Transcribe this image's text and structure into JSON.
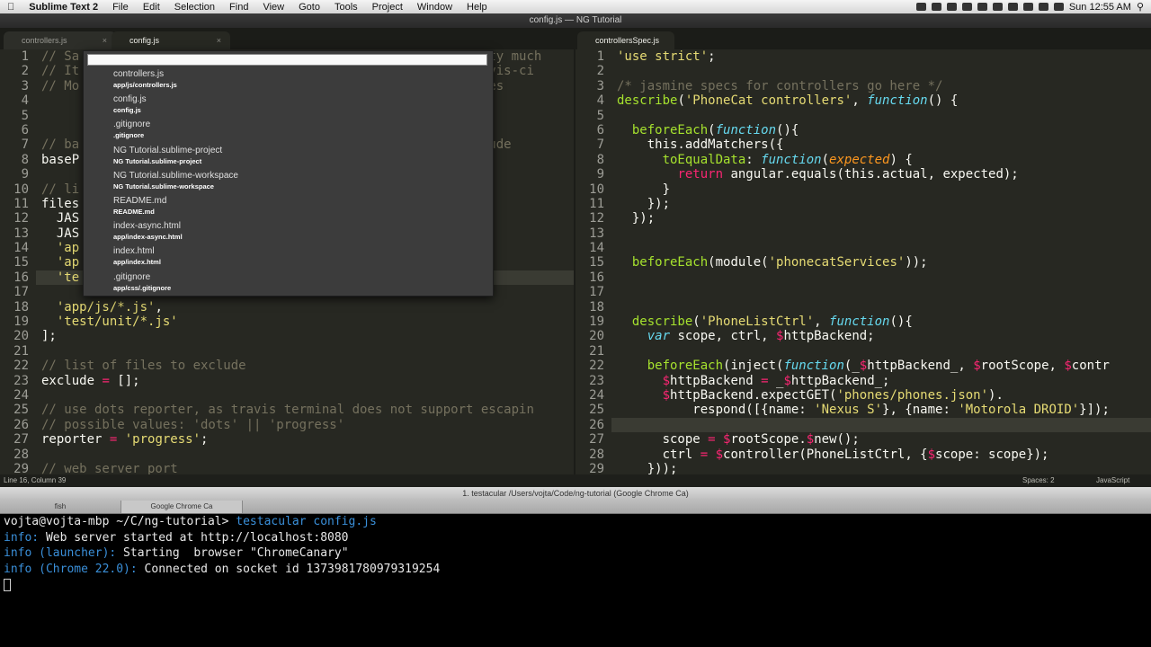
{
  "menubar": {
    "app": "Sublime Text 2",
    "items": [
      "File",
      "Edit",
      "Selection",
      "Find",
      "View",
      "Goto",
      "Tools",
      "Project",
      "Window",
      "Help"
    ],
    "clock": "Sun 12:55 AM"
  },
  "window_title": "config.js — NG Tutorial",
  "left_tabs": [
    {
      "label": "controllers.js",
      "close": "×"
    },
    {
      "label": "config.js",
      "close": "×"
    }
  ],
  "right_tabs": [
    {
      "label": "controllersSpec.js"
    }
  ],
  "goto_anything": {
    "input_value": "",
    "items": [
      {
        "name": "controllers.js",
        "path": "app/js/controllers.js"
      },
      {
        "name": "config.js",
        "path": "config.js"
      },
      {
        "name": ".gitignore",
        "path": ".gitignore"
      },
      {
        "name": "NG Tutorial.sublime-project",
        "path": "NG Tutorial.sublime-project"
      },
      {
        "name": "NG Tutorial.sublime-workspace",
        "path": "NG Tutorial.sublime-workspace"
      },
      {
        "name": "README.md",
        "path": "README.md"
      },
      {
        "name": "index-async.html",
        "path": "app/index-async.html"
      },
      {
        "name": "index.html",
        "path": "app/index.html"
      },
      {
        "name": ".gitignore",
        "path": "app/css/.gitignore"
      }
    ]
  },
  "left_code": {
    "current_line": 16,
    "lines": [
      {
        "n": "1",
        "t": [
          [
            "c",
            "// Sa"
          ],
          [
            "c",
            "                                                  pretty much"
          ]
        ]
      },
      {
        "n": "2",
        "t": [
          [
            "c",
            "// It"
          ],
          [
            "c",
            "                                                  /travis-ci"
          ]
        ]
      },
      {
        "n": "3",
        "t": [
          [
            "c",
            "// Mo"
          ],
          [
            "c",
            "                                              s (see tes"
          ]
        ]
      },
      {
        "n": "4",
        "t": []
      },
      {
        "n": "5",
        "t": []
      },
      {
        "n": "6",
        "t": []
      },
      {
        "n": "7",
        "t": [
          [
            "c",
            "// ba"
          ],
          [
            "c",
            "                                                   xclude"
          ]
        ]
      },
      {
        "n": "8",
        "t": [
          [
            "",
            "baseP"
          ]
        ]
      },
      {
        "n": "9",
        "t": []
      },
      {
        "n": "10",
        "t": [
          [
            "c",
            "// li"
          ]
        ]
      },
      {
        "n": "11",
        "t": [
          [
            "",
            "files"
          ]
        ]
      },
      {
        "n": "12",
        "t": [
          [
            "",
            "  JAS"
          ]
        ]
      },
      {
        "n": "13",
        "t": [
          [
            "",
            "  JAS"
          ]
        ]
      },
      {
        "n": "14",
        "t": [
          [
            "s",
            "  'ap"
          ]
        ]
      },
      {
        "n": "15",
        "t": [
          [
            "s",
            "  'ap"
          ]
        ]
      },
      {
        "n": "16",
        "t": [
          [
            "s",
            "  'te"
          ]
        ]
      },
      {
        "n": "17",
        "t": []
      },
      {
        "n": "18",
        "t": [
          [
            "s",
            "  'app/js/*.js'"
          ],
          [
            "",
            ","
          ]
        ]
      },
      {
        "n": "19",
        "t": [
          [
            "s",
            "  'test/unit/*.js'"
          ]
        ]
      },
      {
        "n": "20",
        "t": [
          [
            "",
            "];"
          ]
        ]
      },
      {
        "n": "21",
        "t": []
      },
      {
        "n": "22",
        "t": [
          [
            "c",
            "// list of files to exclude"
          ]
        ]
      },
      {
        "n": "23",
        "t": [
          [
            "",
            "exclude "
          ],
          [
            "k",
            "="
          ],
          [
            "",
            " [];"
          ]
        ]
      },
      {
        "n": "24",
        "t": []
      },
      {
        "n": "25",
        "t": [
          [
            "c",
            "// use dots reporter, as travis terminal does not support escapin"
          ]
        ]
      },
      {
        "n": "26",
        "t": [
          [
            "c",
            "// possible values: 'dots' || 'progress'"
          ]
        ]
      },
      {
        "n": "27",
        "t": [
          [
            "",
            "reporter "
          ],
          [
            "k",
            "="
          ],
          [
            "",
            " "
          ],
          [
            "s",
            "'progress'"
          ],
          [
            "",
            ";"
          ]
        ]
      },
      {
        "n": "28",
        "t": []
      },
      {
        "n": "29",
        "t": [
          [
            "c",
            "// web server port"
          ]
        ]
      }
    ]
  },
  "right_code": {
    "current_line": 26,
    "lines": [
      {
        "n": "1",
        "t": [
          [
            "s",
            "'use strict'"
          ],
          [
            "",
            ";"
          ]
        ]
      },
      {
        "n": "2",
        "t": []
      },
      {
        "n": "3",
        "t": [
          [
            "c",
            "/* jasmine specs for controllers go here */"
          ]
        ]
      },
      {
        "n": "4",
        "t": [
          [
            "f",
            "describe"
          ],
          [
            "",
            "("
          ],
          [
            "s",
            "'PhoneCat controllers'"
          ],
          [
            "",
            ", "
          ],
          [
            "kw",
            "function"
          ],
          [
            "",
            "() {"
          ]
        ]
      },
      {
        "n": "5",
        "t": []
      },
      {
        "n": "6",
        "t": [
          [
            "",
            "  "
          ],
          [
            "f",
            "beforeEach"
          ],
          [
            "",
            "("
          ],
          [
            "kw",
            "function"
          ],
          [
            "",
            "(){"
          ]
        ]
      },
      {
        "n": "7",
        "t": [
          [
            "",
            "    this.addMatchers({"
          ]
        ]
      },
      {
        "n": "8",
        "t": [
          [
            "",
            "      "
          ],
          [
            "f",
            "toEqualData"
          ],
          [
            "",
            ": "
          ],
          [
            "kw",
            "function"
          ],
          [
            "",
            "("
          ],
          [
            "p",
            "expected"
          ],
          [
            "",
            ") {"
          ]
        ]
      },
      {
        "n": "9",
        "t": [
          [
            "",
            "        "
          ],
          [
            "k",
            "return"
          ],
          [
            "",
            " angular.equals(this.actual, expected);"
          ]
        ]
      },
      {
        "n": "10",
        "t": [
          [
            "",
            "      }"
          ]
        ]
      },
      {
        "n": "11",
        "t": [
          [
            "",
            "    });"
          ]
        ]
      },
      {
        "n": "12",
        "t": [
          [
            "",
            "  });"
          ]
        ]
      },
      {
        "n": "13",
        "t": []
      },
      {
        "n": "14",
        "t": []
      },
      {
        "n": "15",
        "t": [
          [
            "",
            "  "
          ],
          [
            "f",
            "beforeEach"
          ],
          [
            "",
            "(module("
          ],
          [
            "s",
            "'phonecatServices'"
          ],
          [
            "",
            "));"
          ]
        ]
      },
      {
        "n": "16",
        "t": []
      },
      {
        "n": "17",
        "t": []
      },
      {
        "n": "18",
        "t": []
      },
      {
        "n": "19",
        "t": [
          [
            "",
            "  "
          ],
          [
            "f",
            "describe"
          ],
          [
            "",
            "("
          ],
          [
            "s",
            "'PhoneListCtrl'"
          ],
          [
            "",
            ", "
          ],
          [
            "kw",
            "function"
          ],
          [
            "",
            "(){"
          ]
        ]
      },
      {
        "n": "20",
        "t": [
          [
            "",
            "    "
          ],
          [
            "kw",
            "var"
          ],
          [
            "",
            " scope, ctrl, "
          ],
          [
            "v",
            "$"
          ],
          [
            "",
            "httpBackend;"
          ]
        ]
      },
      {
        "n": "21",
        "t": []
      },
      {
        "n": "22",
        "t": [
          [
            "",
            "    "
          ],
          [
            "f",
            "beforeEach"
          ],
          [
            "",
            "(inject("
          ],
          [
            "kw",
            "function"
          ],
          [
            "",
            "(_"
          ],
          [
            "v",
            "$"
          ],
          [
            "",
            "httpBackend_, "
          ],
          [
            "v",
            "$"
          ],
          [
            "",
            "rootScope, "
          ],
          [
            "v",
            "$"
          ],
          [
            "",
            "contr"
          ]
        ]
      },
      {
        "n": "23",
        "t": [
          [
            "",
            "      "
          ],
          [
            "v",
            "$"
          ],
          [
            "",
            "httpBackend "
          ],
          [
            "k",
            "="
          ],
          [
            "",
            " _"
          ],
          [
            "v",
            "$"
          ],
          [
            "",
            "httpBackend_;"
          ]
        ]
      },
      {
        "n": "24",
        "t": [
          [
            "",
            "      "
          ],
          [
            "v",
            "$"
          ],
          [
            "",
            "httpBackend.expectGET("
          ],
          [
            "s",
            "'phones/phones.json'"
          ],
          [
            "",
            ")."
          ]
        ]
      },
      {
        "n": "25",
        "t": [
          [
            "",
            "          respond([{name: "
          ],
          [
            "s",
            "'Nexus S'"
          ],
          [
            "",
            "}, {name: "
          ],
          [
            "s",
            "'Motorola DROID'"
          ],
          [
            "",
            "}]);"
          ]
        ]
      },
      {
        "n": "26",
        "t": []
      },
      {
        "n": "27",
        "t": [
          [
            "",
            "      scope "
          ],
          [
            "k",
            "="
          ],
          [
            "",
            " "
          ],
          [
            "v",
            "$"
          ],
          [
            "",
            "rootScope."
          ],
          [
            "v",
            "$"
          ],
          [
            "",
            "new"
          ],
          [
            "",
            "();"
          ]
        ]
      },
      {
        "n": "28",
        "t": [
          [
            "",
            "      ctrl "
          ],
          [
            "k",
            "="
          ],
          [
            "",
            " "
          ],
          [
            "v",
            "$"
          ],
          [
            "",
            "controller(PhoneListCtrl, {"
          ],
          [
            "v",
            "$"
          ],
          [
            "",
            "scope: scope});"
          ]
        ]
      },
      {
        "n": "29",
        "t": [
          [
            "",
            "    }));"
          ]
        ]
      }
    ]
  },
  "statusbar": {
    "position": "Line 16, Column 39",
    "spaces": "Spaces: 2",
    "syntax": "JavaScript"
  },
  "terminal": {
    "title": "1. testacular  /Users/vojta/Code/ng-tutorial (Google Chrome Ca)",
    "tabs": [
      "fish",
      "Google Chrome Ca"
    ],
    "prompt": "vojta@vojta-mbp ~/C/ng-tutorial> ",
    "command": "testacular config.js",
    "lines": [
      {
        "label": "info:",
        "text": " Web server started at http://localhost:8080"
      },
      {
        "label": "info (launcher):",
        "text": " Starting  browser \"ChromeCanary\""
      },
      {
        "label": "info (Chrome 22.0):",
        "text": " Connected on socket id 1373981780979319254"
      }
    ]
  }
}
